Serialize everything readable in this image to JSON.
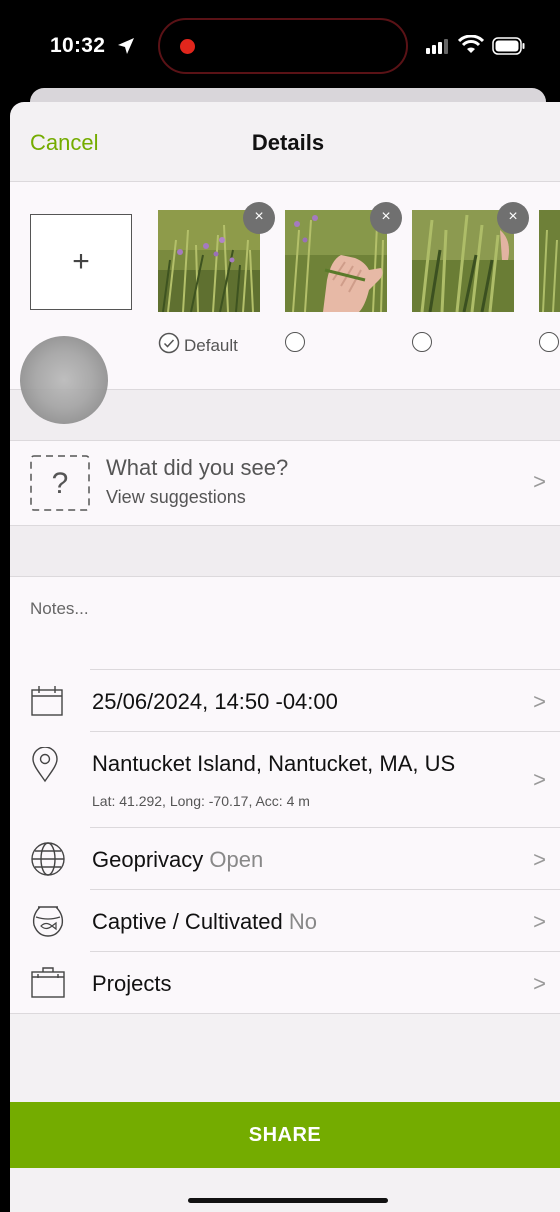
{
  "status_bar": {
    "time": "10:32"
  },
  "nav": {
    "cancel": "Cancel",
    "title": "Details"
  },
  "photos": {
    "add_symbol": "+",
    "default_label": "Default",
    "remove_symbol": "×"
  },
  "suggestion": {
    "title": "What did you see?",
    "subtitle": "View suggestions"
  },
  "notes": {
    "placeholder": "Notes..."
  },
  "rows": {
    "date": {
      "label": "25/06/2024, 14:50 -04:00"
    },
    "location": {
      "label": "Nantucket Island, Nantucket, MA, US",
      "sub": "Lat: 41.292, Long: -70.17, Acc: 4 m"
    },
    "geoprivacy": {
      "label": "Geoprivacy",
      "value": "Open"
    },
    "captive": {
      "label": "Captive / Cultivated",
      "value": "No"
    },
    "projects": {
      "label": "Projects"
    }
  },
  "chevron": ">",
  "share": {
    "label": "SHARE"
  },
  "colors": {
    "accent": "#74ac00",
    "recording": "#e1261c"
  }
}
